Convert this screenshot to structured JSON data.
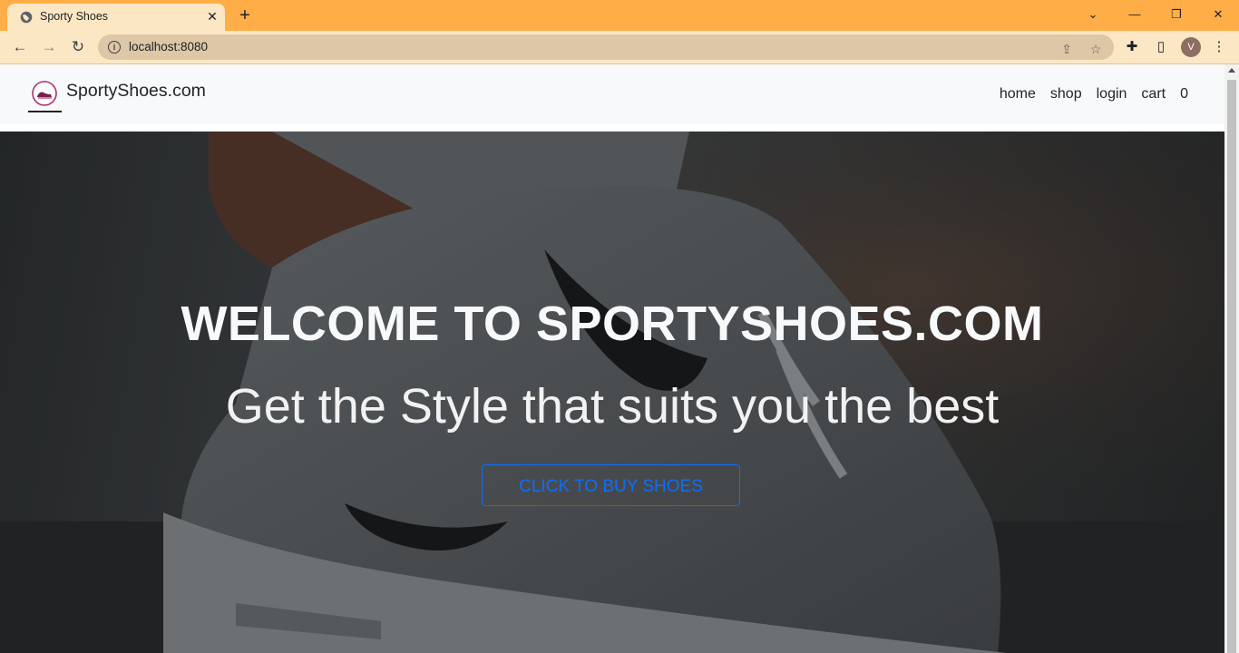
{
  "browser": {
    "tab_title": "Sporty Shoes",
    "url": "localhost:8080",
    "profile_initial": "V",
    "tab_color": "#ffad46",
    "toolbar_color": "#fbe7c4"
  },
  "navbar": {
    "brand": "SportyShoes.com",
    "links": [
      {
        "label": "home"
      },
      {
        "label": "shop"
      },
      {
        "label": "login"
      },
      {
        "label": "cart"
      },
      {
        "label": "0"
      }
    ]
  },
  "hero": {
    "title": "WELCOME TO SPORTYSHOES.COM",
    "subtitle": "Get the Style that suits you the best",
    "button_label": "CLICK TO BUY SHOES",
    "accent_color": "#0d6efd"
  }
}
